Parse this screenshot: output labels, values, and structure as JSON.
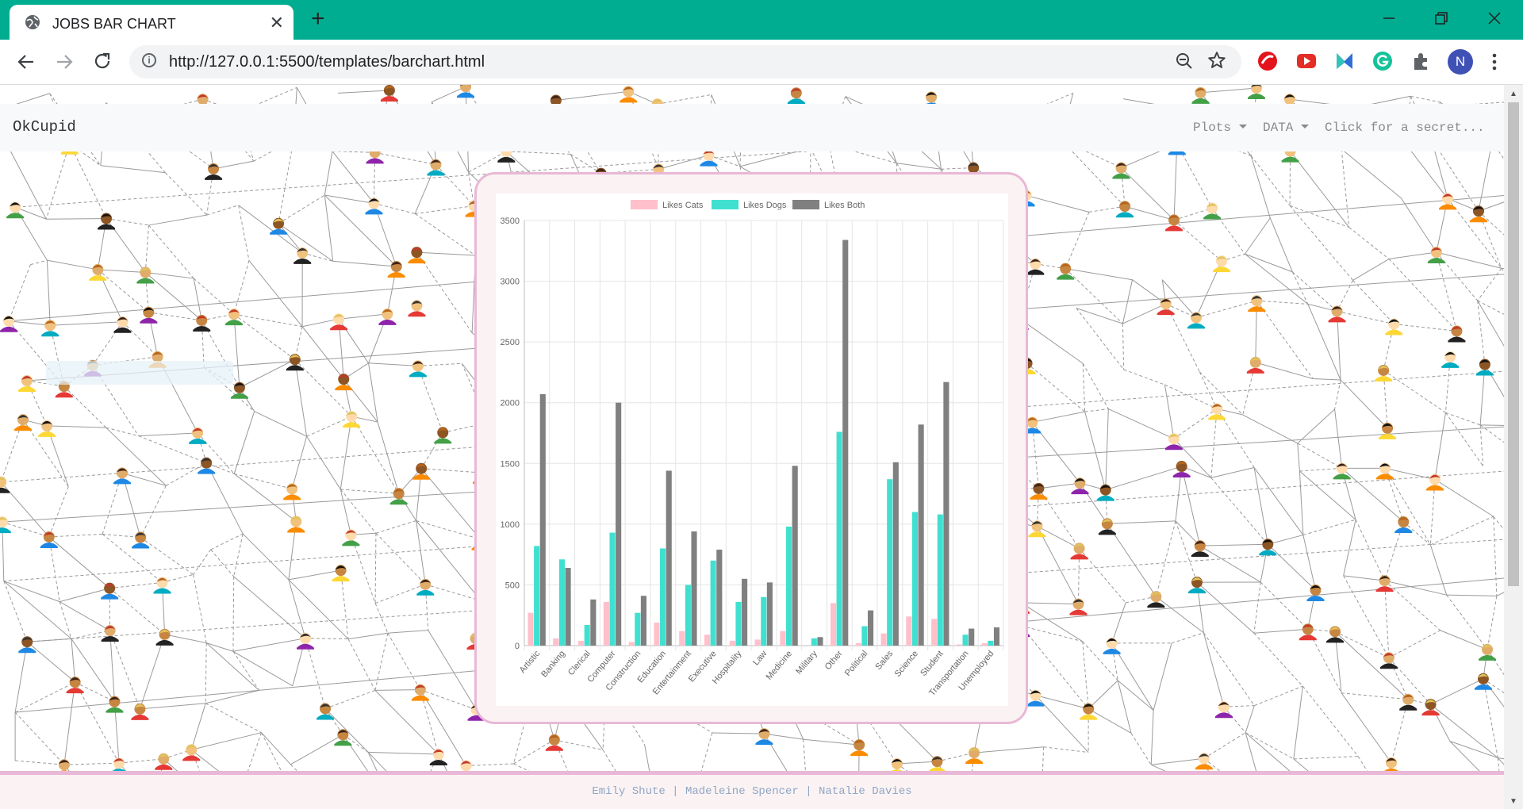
{
  "browser": {
    "tab_title": "JOBS BAR CHART",
    "tab_close": "✕",
    "new_tab": "+",
    "url": "http://127.0.0.1:5500/templates/barchart.html",
    "avatar_letter": "N",
    "theme_color": "#00ad91"
  },
  "navbar": {
    "brand": "OkCupid",
    "links": [
      {
        "label": "Plots"
      },
      {
        "label": "DATA"
      },
      {
        "label": "Click for a secret..."
      }
    ]
  },
  "footer": {
    "text": "Emily Shute | Madeleine Spencer | Natalie Davies"
  },
  "chart_data": {
    "type": "bar",
    "categories": [
      "Artistic",
      "Banking",
      "Clerical",
      "Computer",
      "Construction",
      "Education",
      "Entertainment",
      "Executive",
      "Hospitality",
      "Law",
      "Medicine",
      "Military",
      "Other",
      "Political",
      "Sales",
      "Science",
      "Student",
      "Transportation",
      "Unemployed"
    ],
    "series": [
      {
        "name": "Likes Cats",
        "color": "#ffc0cb",
        "values": [
          270,
          60,
          40,
          360,
          30,
          190,
          120,
          90,
          40,
          50,
          120,
          0,
          350,
          20,
          100,
          240,
          220,
          10,
          20
        ]
      },
      {
        "name": "Likes Dogs",
        "color": "#40e0d0",
        "values": [
          820,
          710,
          170,
          930,
          270,
          800,
          500,
          700,
          360,
          400,
          980,
          60,
          1760,
          160,
          1370,
          1100,
          1080,
          90,
          40
        ]
      },
      {
        "name": "Likes Both",
        "color": "#808080",
        "values": [
          2070,
          640,
          380,
          2000,
          410,
          1440,
          940,
          790,
          550,
          520,
          1480,
          70,
          3340,
          290,
          1510,
          1820,
          2170,
          140,
          150
        ]
      }
    ],
    "yticks": [
      0,
      500,
      1000,
      1500,
      2000,
      2500,
      3000,
      3500
    ],
    "ylim": [
      0,
      3500
    ],
    "legend_position": "top",
    "grid": true
  }
}
